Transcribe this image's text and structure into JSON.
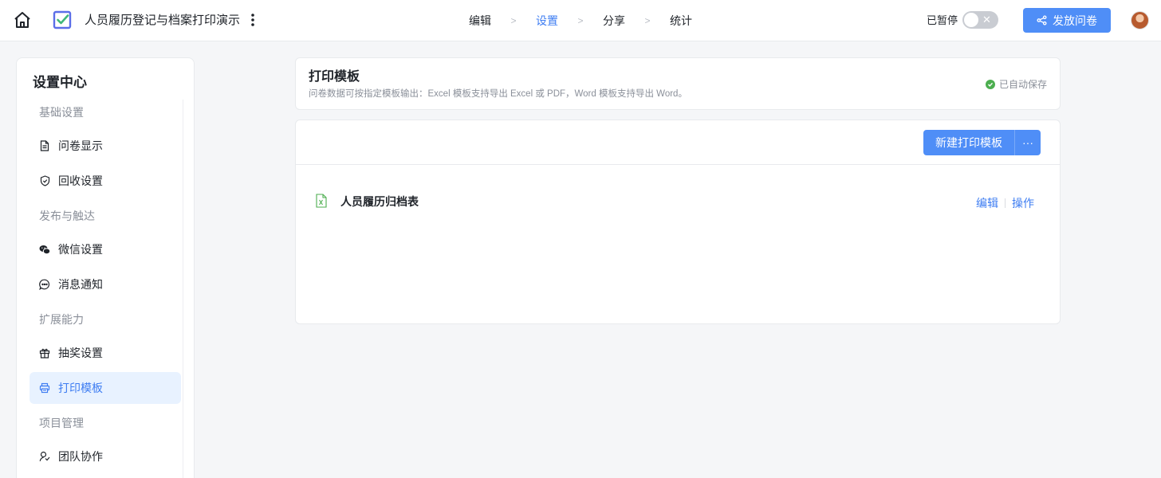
{
  "header": {
    "form_title": "人员履历登记与档案打印演示",
    "steps": [
      {
        "label": "编辑",
        "active": false
      },
      {
        "label": "设置",
        "active": true
      },
      {
        "label": "分享",
        "active": false
      },
      {
        "label": "统计",
        "active": false
      }
    ],
    "paused_label": "已暂停",
    "toggle_on": false,
    "publish_label": "发放问卷"
  },
  "sidebar": {
    "title": "设置中心",
    "groups": [
      {
        "label": "基础设置",
        "items": [
          {
            "label": "问卷显示",
            "icon": "document-icon"
          },
          {
            "label": "回收设置",
            "icon": "shield-check-icon"
          }
        ]
      },
      {
        "label": "发布与触达",
        "items": [
          {
            "label": "微信设置",
            "icon": "wechat-icon"
          },
          {
            "label": "消息通知",
            "icon": "chat-bubble-icon"
          }
        ]
      },
      {
        "label": "扩展能力",
        "items": [
          {
            "label": "抽奖设置",
            "icon": "gift-icon"
          },
          {
            "label": "打印模板",
            "icon": "printer-icon",
            "active": true
          }
        ]
      },
      {
        "label": "项目管理",
        "items": [
          {
            "label": "团队协作",
            "icon": "team-icon"
          }
        ]
      }
    ]
  },
  "print_header": {
    "title": "打印模板",
    "description": "问卷数据可按指定模板输出：Excel 模板支持导出 Excel 或 PDF，Word 模板支持导出 Word。",
    "autosave_label": "已自动保存"
  },
  "templates": {
    "new_button_label": "新建打印模板",
    "more_label": "···",
    "items": [
      {
        "name": "人员履历归档表",
        "type": "excel",
        "edit_label": "编辑",
        "action_label": "操作"
      }
    ]
  },
  "colors": {
    "accent": "#3e7df2",
    "primary_button": "#4f8ef7",
    "active_bg": "#e8f2ff",
    "success": "#4cae4f",
    "excel": "#4cae4f"
  }
}
